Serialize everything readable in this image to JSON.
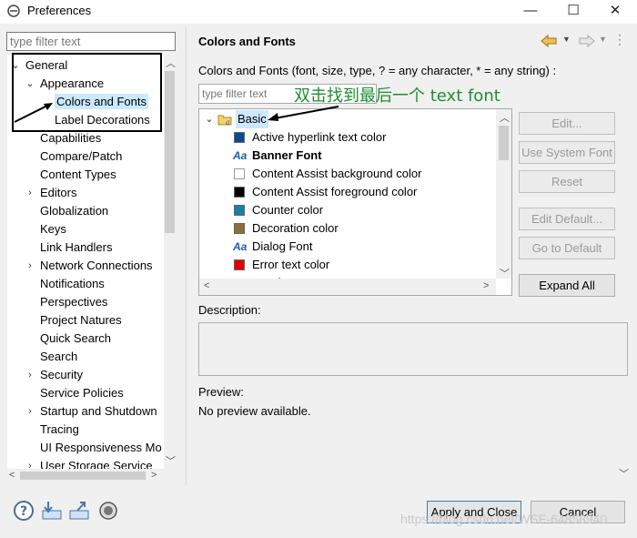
{
  "window": {
    "title": "Preferences",
    "minimize": "—",
    "maximize": "☐",
    "close": "✕"
  },
  "left": {
    "filter_placeholder": "type filter text",
    "tree": [
      {
        "label": "General",
        "depth": 0,
        "expanded": true
      },
      {
        "label": "Appearance",
        "depth": 1,
        "expanded": true
      },
      {
        "label": "Colors and Fonts",
        "depth": 2,
        "selected": true
      },
      {
        "label": "Label Decorations",
        "depth": 2
      },
      {
        "label": "Capabilities",
        "depth": 1
      },
      {
        "label": "Compare/Patch",
        "depth": 1
      },
      {
        "label": "Content Types",
        "depth": 1
      },
      {
        "label": "Editors",
        "depth": 1,
        "collapsed": true
      },
      {
        "label": "Globalization",
        "depth": 1
      },
      {
        "label": "Keys",
        "depth": 1
      },
      {
        "label": "Link Handlers",
        "depth": 1
      },
      {
        "label": "Network Connections",
        "depth": 1,
        "collapsed": true
      },
      {
        "label": "Notifications",
        "depth": 1
      },
      {
        "label": "Perspectives",
        "depth": 1
      },
      {
        "label": "Project Natures",
        "depth": 1
      },
      {
        "label": "Quick Search",
        "depth": 1
      },
      {
        "label": "Search",
        "depth": 1
      },
      {
        "label": "Security",
        "depth": 1,
        "collapsed": true
      },
      {
        "label": "Service Policies",
        "depth": 1
      },
      {
        "label": "Startup and Shutdown",
        "depth": 1,
        "collapsed": true
      },
      {
        "label": "Tracing",
        "depth": 1
      },
      {
        "label": "UI Responsiveness Mo",
        "depth": 1
      },
      {
        "label": "User Storage Service",
        "depth": 1,
        "collapsed": true
      }
    ]
  },
  "right": {
    "title": "Colors and Fonts",
    "description": "Colors and Fonts (font, size, type, ? = any character, * = any string) :",
    "filter_placeholder": "type filter text",
    "annotation": "双击找到最后一个 text font",
    "tree": [
      {
        "label": "Basic",
        "kind": "folder"
      },
      {
        "label": "Active hyperlink text color",
        "kind": "color",
        "color": "#0b4a8f"
      },
      {
        "label": "Banner Font",
        "kind": "font",
        "bold": true
      },
      {
        "label": "Content Assist background color",
        "kind": "color",
        "color": "#ffffff"
      },
      {
        "label": "Content Assist foreground color",
        "kind": "color",
        "color": "#000000"
      },
      {
        "label": "Counter color",
        "kind": "color",
        "color": "#1a7fa8"
      },
      {
        "label": "Decoration color",
        "kind": "color",
        "color": "#8b6f3c"
      },
      {
        "label": "Dialog Font",
        "kind": "font"
      },
      {
        "label": "Error text color",
        "kind": "color",
        "color": "#e00000"
      },
      {
        "label": "Header Font",
        "kind": "font",
        "bold": true
      }
    ],
    "buttons": {
      "edit": "Edit...",
      "use_system_font": "Use System Font",
      "reset": "Reset",
      "edit_default": "Edit Default...",
      "go_to_default": "Go to Default",
      "expand_all": "Expand All"
    },
    "description_label": "Description:",
    "preview_label": "Preview:",
    "preview_text": "No preview available."
  },
  "bottom": {
    "apply_and_close": "Apply and Close",
    "cancel": "Cancel",
    "watermark": "https://blog.csdn.net/WSF-64858940"
  },
  "icons": {
    "help": "help-icon",
    "import": "import-icon",
    "export": "export-icon",
    "oomph": "oomph-icon",
    "back": "back-arrow-icon",
    "forward": "forward-arrow-icon",
    "menu": "view-menu-icon"
  }
}
